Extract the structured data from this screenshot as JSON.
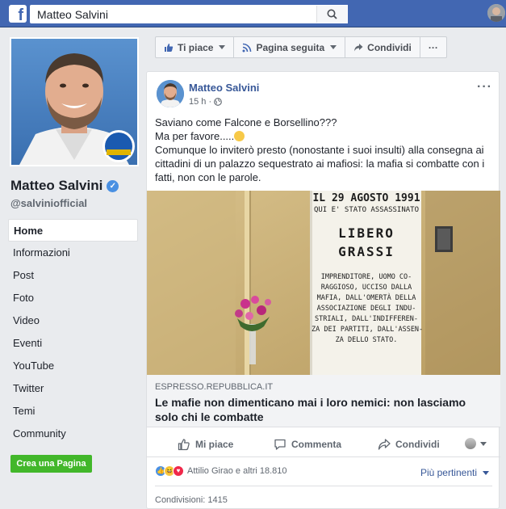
{
  "topbar": {
    "logo": "f",
    "search_value": "Matteo Salvini",
    "search_icon": "search-icon"
  },
  "page": {
    "name": "Matteo Salvini",
    "handle": "@salviniofficial",
    "verified_icon": "verified-badge-icon"
  },
  "nav": {
    "items": [
      "Home",
      "Informazioni",
      "Post",
      "Foto",
      "Video",
      "Eventi",
      "YouTube",
      "Twitter",
      "Temi",
      "Community"
    ],
    "active": "Home"
  },
  "create_page_label": "Crea una Pagina",
  "actionbar": {
    "like_label": "Ti piace",
    "follow_label": "Pagina seguita",
    "share_label": "Condividi",
    "more_label": "···"
  },
  "post": {
    "author": "Matteo Salvini",
    "time": "15 h ·",
    "menu": "···",
    "text_line1": "Saviano come Falcone e Borsellino???",
    "text_line2": "Ma per favore.....",
    "text_line3": "Comunque lo inviterò presto (nonostante i suoi insulti) alla consegna ai cittadini di un palazzo sequestrato ai mafiosi: la mafia si combatte con i fatti, non con le parole.",
    "poster": {
      "line1": "IL 29 AGOSTO 1991",
      "line2": "QUI E' STATO ASSASSINATO",
      "name1": "LIBERO",
      "name2": "GRASSI",
      "body": [
        "IMPRENDITORE, UOMO CO-",
        "RAGGIOSO, UCCISO DALLA",
        "MAFIA, DALL'OMERTÀ DELLA",
        "ASSOCIAZIONE DEGLI INDU-",
        "STRIALI, DALL'INDIFFEREN-",
        "ZA DEI PARTITI, DALL'ASSEN-",
        "ZA DELLO STATO."
      ]
    },
    "link_domain": "ESPRESSO.REPUBBLICA.IT",
    "link_title": "Le mafie non dimenticano mai i loro nemici: non lasciamo solo chi le combatte",
    "actions": {
      "like": "Mi piace",
      "comment": "Commenta",
      "share": "Condividi"
    },
    "reactions_text": "Attilio Girao e altri 18.810",
    "sort_label": "Più pertinenti",
    "shares_text": "Condivisioni: 1415"
  },
  "colors": {
    "brand": "#4267b2",
    "link": "#385898",
    "green": "#42b72a"
  }
}
